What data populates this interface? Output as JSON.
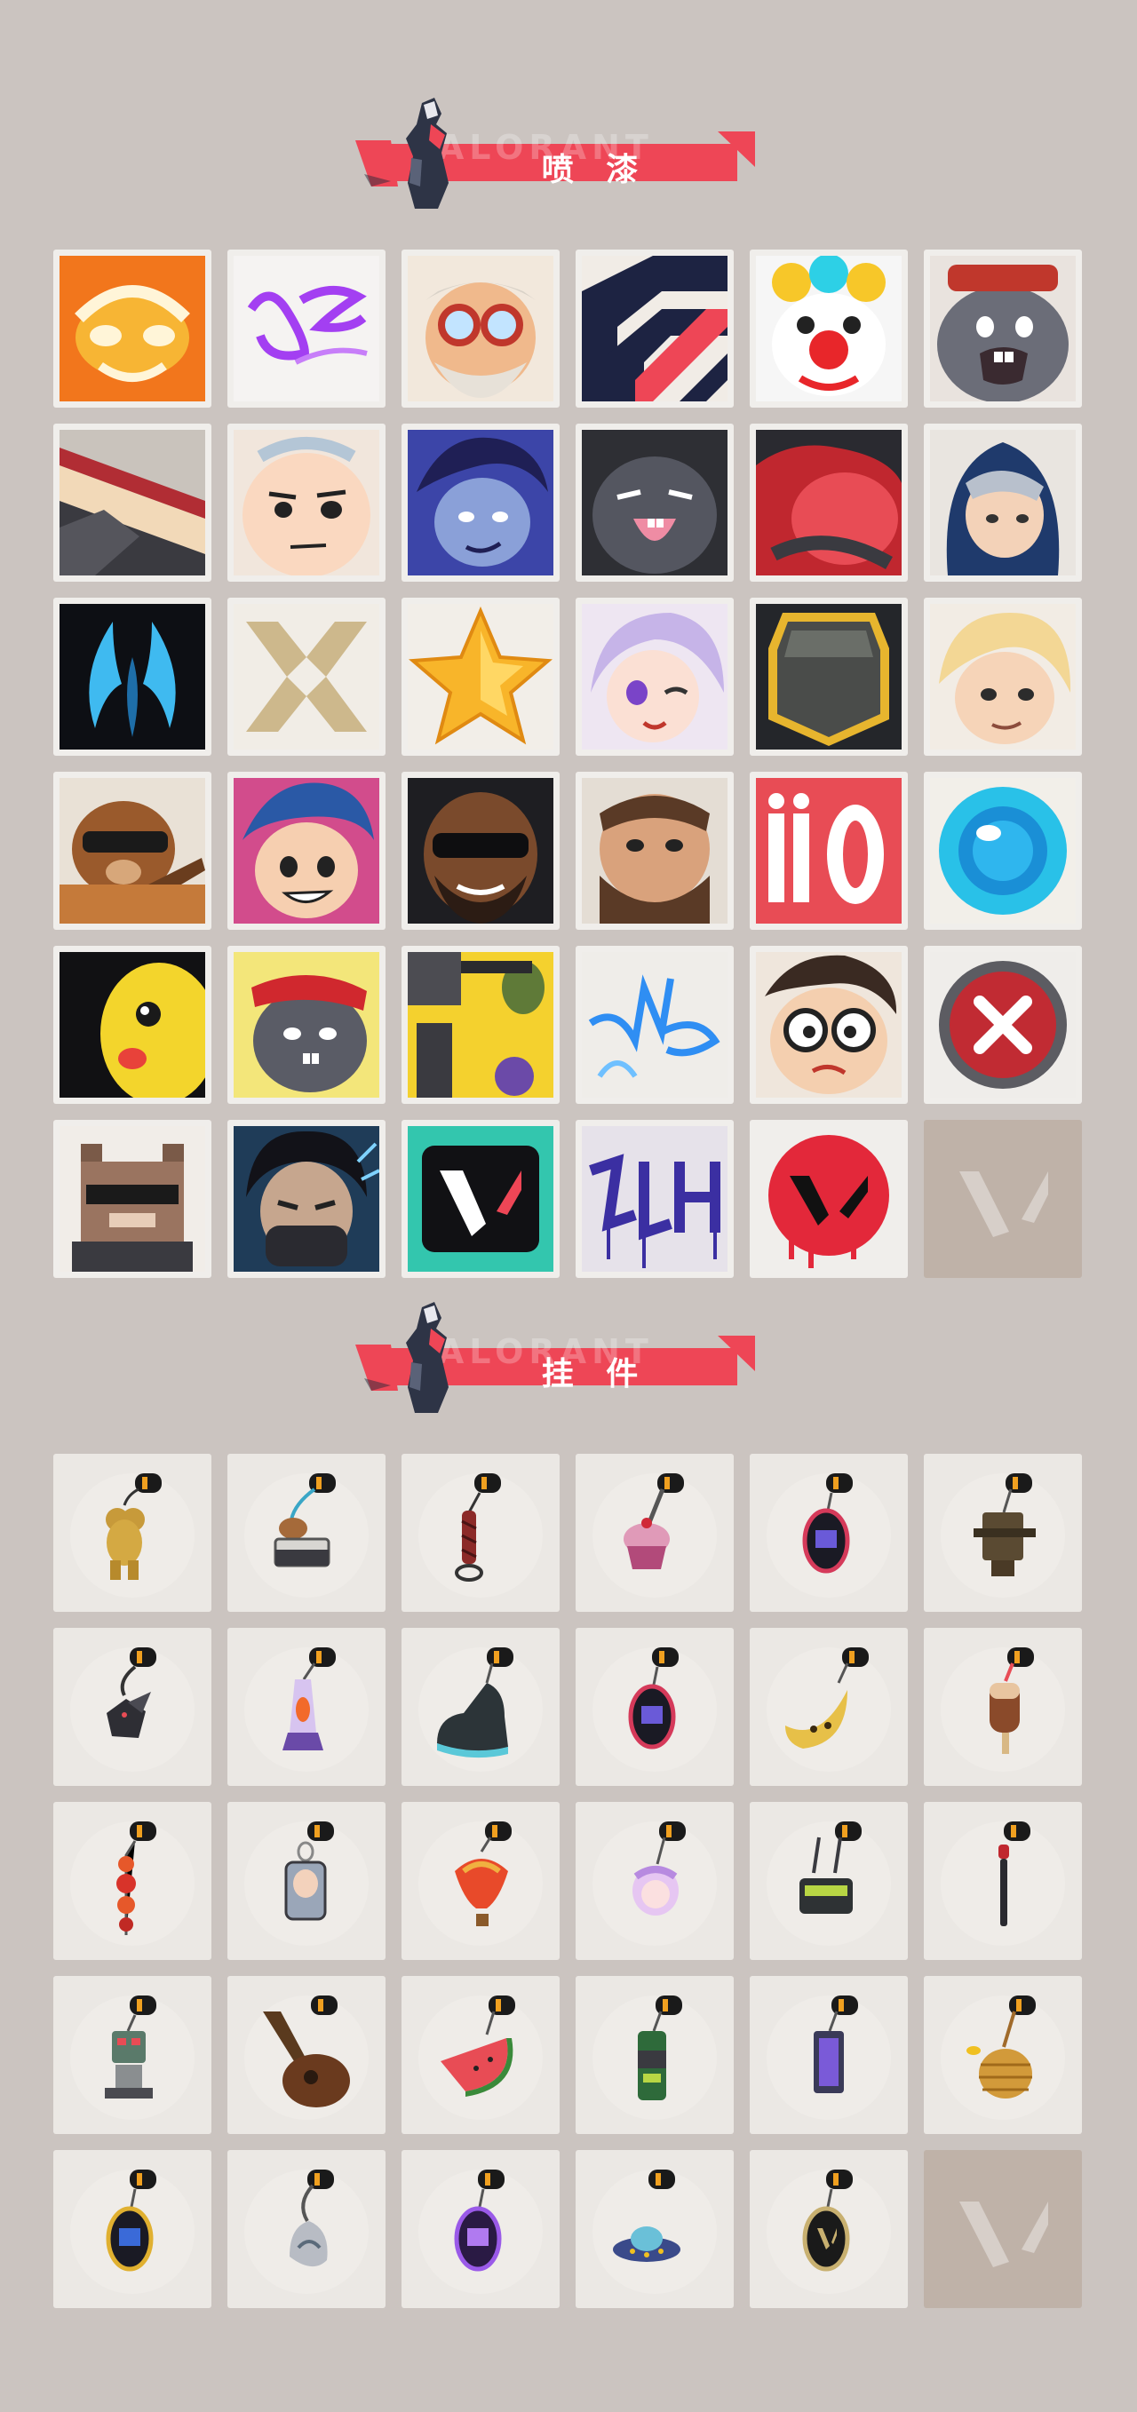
{
  "sections": {
    "sprays": {
      "title": "喷  漆",
      "ghost_text": "VALORANT"
    },
    "charms": {
      "title": "挂  件",
      "ghost_text": "VALORANT"
    }
  },
  "colors": {
    "background": "#cbc4c0",
    "ribbon": "#ee4656",
    "tile": "#f0eeeb",
    "empty_tile": "#bfb2a8"
  },
  "sprays": [
    {
      "icon": "orange-mask-face-spray-icon"
    },
    {
      "icon": "purple-graffiti-tag-spray-icon"
    },
    {
      "icon": "goggles-old-man-spray-icon"
    },
    {
      "icon": "navy-chevron-logo-spray-icon"
    },
    {
      "icon": "clown-face-spray-icon"
    },
    {
      "icon": "crying-gray-blob-spray-icon"
    },
    {
      "icon": "cake-slice-spray-icon"
    },
    {
      "icon": "smug-face-spray-icon"
    },
    {
      "icon": "smirking-agent-spray-icon"
    },
    {
      "icon": "laughing-gray-blob-spray-icon"
    },
    {
      "icon": "red-blob-closeup-spray-icon"
    },
    {
      "icon": "hooded-agent-spray-icon"
    },
    {
      "icon": "blue-flame-logo-spray-icon"
    },
    {
      "icon": "gold-x-logo-spray-icon"
    },
    {
      "icon": "gold-star-spray-icon"
    },
    {
      "icon": "winking-agent-spray-icon"
    },
    {
      "icon": "green-bomb-spray-icon"
    },
    {
      "icon": "blonde-agent-spray-icon"
    },
    {
      "icon": "sunglasses-bear-guitar-spray-icon"
    },
    {
      "icon": "grinning-agent-spray-icon"
    },
    {
      "icon": "bearded-sunglasses-agent-spray-icon"
    },
    {
      "icon": "bearded-agent-spray-icon"
    },
    {
      "icon": "ii0-text-spray-icon"
    },
    {
      "icon": "blue-orb-spray-icon"
    },
    {
      "icon": "yellow-creature-spray-icon"
    },
    {
      "icon": "bandana-gray-blob-spray-icon"
    },
    {
      "icon": "gadgets-collage-spray-icon"
    },
    {
      "icon": "blue-neon-graffiti-spray-icon"
    },
    {
      "icon": "glasses-agent-spray-icon"
    },
    {
      "icon": "red-x-button-spray-icon"
    },
    {
      "icon": "pixel-cat-sunglasses-spray-icon"
    },
    {
      "icon": "masked-agent-spray-icon"
    },
    {
      "icon": "teal-v-logo-spray-icon"
    },
    {
      "icon": "purple-drip-graffiti-spray-icon"
    },
    {
      "icon": "red-v-drip-logo-spray-icon"
    },
    {
      "icon": "empty-slot-icon"
    }
  ],
  "charms": [
    {
      "icon": "gold-bear-charm-icon"
    },
    {
      "icon": "lunchbox-charm-icon"
    },
    {
      "icon": "braided-cord-charm-icon"
    },
    {
      "icon": "cupcake-charm-icon"
    },
    {
      "icon": "episode-9-medallion-charm-icon"
    },
    {
      "icon": "radio-device-charm-icon"
    },
    {
      "icon": "dragon-charm-icon"
    },
    {
      "icon": "lava-lamp-charm-icon"
    },
    {
      "icon": "sneaker-charm-icon"
    },
    {
      "icon": "episode-9-purple-medallion-charm-icon"
    },
    {
      "icon": "banana-charm-icon"
    },
    {
      "icon": "popsicle-charm-icon"
    },
    {
      "icon": "red-beads-charm-icon"
    },
    {
      "icon": "agent-keychain-charm-icon"
    },
    {
      "icon": "hot-air-balloon-charm-icon"
    },
    {
      "icon": "pink-agent-charm-icon"
    },
    {
      "icon": "green-device-charm-icon"
    },
    {
      "icon": "microphone-charm-icon"
    },
    {
      "icon": "robot-figure-charm-icon"
    },
    {
      "icon": "lute-charm-icon"
    },
    {
      "icon": "watermelon-slice-charm-icon"
    },
    {
      "icon": "soda-can-charm-icon"
    },
    {
      "icon": "purple-lantern-charm-icon"
    },
    {
      "icon": "beehive-charm-icon"
    },
    {
      "icon": "episode-9-blue-medallion-charm-icon"
    },
    {
      "icon": "silver-shell-charm-icon"
    },
    {
      "icon": "episode-8-medallion-charm-icon"
    },
    {
      "icon": "ufo-charm-icon"
    },
    {
      "icon": "v-logo-medallion-charm-icon"
    },
    {
      "icon": "empty-slot-icon"
    }
  ]
}
